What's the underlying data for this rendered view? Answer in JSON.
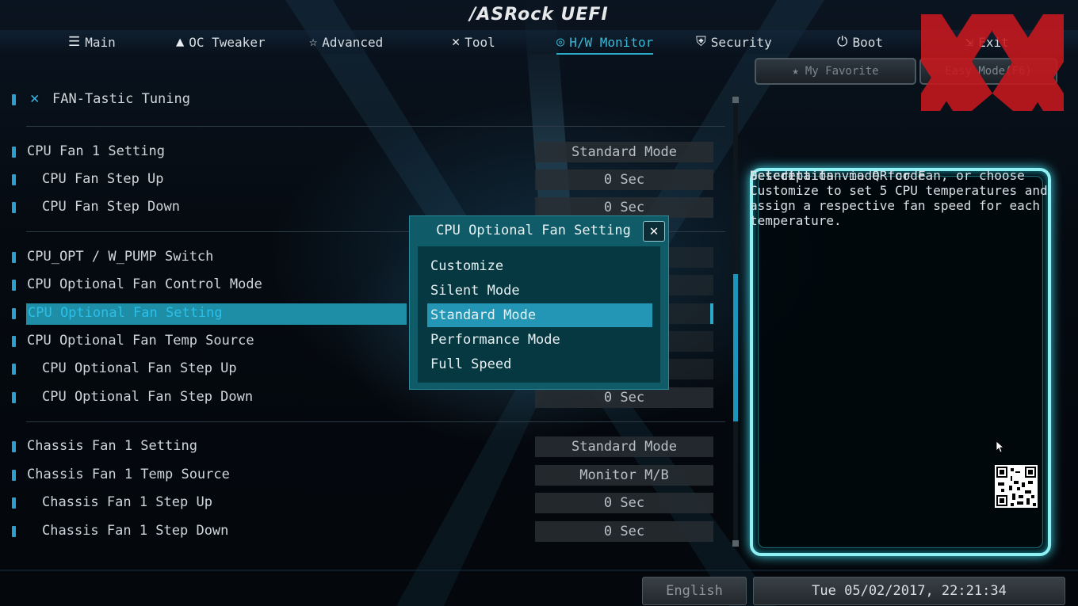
{
  "app": {
    "logo": "/ASRock UEFI"
  },
  "tabs": [
    {
      "label": "Main",
      "icon": "list-icon"
    },
    {
      "label": "OC Tweaker",
      "icon": "rocket-icon"
    },
    {
      "label": "Advanced",
      "icon": "star-icon"
    },
    {
      "label": "Tool",
      "icon": "tools-icon"
    },
    {
      "label": "H/W Monitor",
      "icon": "monitor-gauge-icon",
      "active": true
    },
    {
      "label": "Security",
      "icon": "shield-icon"
    },
    {
      "label": "Boot",
      "icon": "power-icon"
    },
    {
      "label": "Exit",
      "icon": "exit-icon"
    }
  ],
  "top_buttons": {
    "favorite": "My Favorite",
    "easy_mode": "Easy Mode(F6)"
  },
  "section": {
    "title": "FAN-Tastic Tuning"
  },
  "settings": [
    {
      "label": "CPU Fan 1 Setting",
      "value": "Standard Mode"
    },
    {
      "label": "CPU Fan Step Up",
      "value": "0 Sec"
    },
    {
      "label": "CPU Fan Step Down",
      "value": "0 Sec"
    },
    {
      "label": "CPU_OPT / W_PUMP Switch",
      "value": ""
    },
    {
      "label": "CPU Optional Fan Control Mode",
      "value": ""
    },
    {
      "label": "CPU Optional Fan Setting",
      "value": ""
    },
    {
      "label": "CPU Optional Fan Temp Source",
      "value": ""
    },
    {
      "label": "CPU Optional Fan Step Up",
      "value": ""
    },
    {
      "label": "CPU Optional Fan Step Down",
      "value": "0 Sec"
    },
    {
      "label": "Chassis Fan 1 Setting",
      "value": "Standard Mode"
    },
    {
      "label": "Chassis Fan 1 Temp Source",
      "value": "Monitor M/B"
    },
    {
      "label": "Chassis Fan 1 Step Up",
      "value": "0 Sec"
    },
    {
      "label": "Chassis Fan 1 Step Down",
      "value": "0 Sec"
    }
  ],
  "description": {
    "title": "Description",
    "text": "Select a fan mode for Fan, or choose Customize to set 5 CPU temperatures and assign a respective fan speed for each temperature.",
    "qr_text": "Get details via QR code"
  },
  "footer": {
    "language": "English",
    "datetime": "Tue 05/02/2017, 22:21:34"
  },
  "modal": {
    "title": "CPU Optional Fan Setting",
    "close": "✕",
    "options": [
      "Customize",
      "Silent Mode",
      "Standard Mode",
      "Performance Mode",
      "Full Speed"
    ],
    "selected": "Standard Mode"
  },
  "colors": {
    "accent": "#2aa9c8",
    "highlight": "#1e8da6",
    "bullet": "#2a9fd0",
    "panel_glow": "#8ff0f4"
  }
}
